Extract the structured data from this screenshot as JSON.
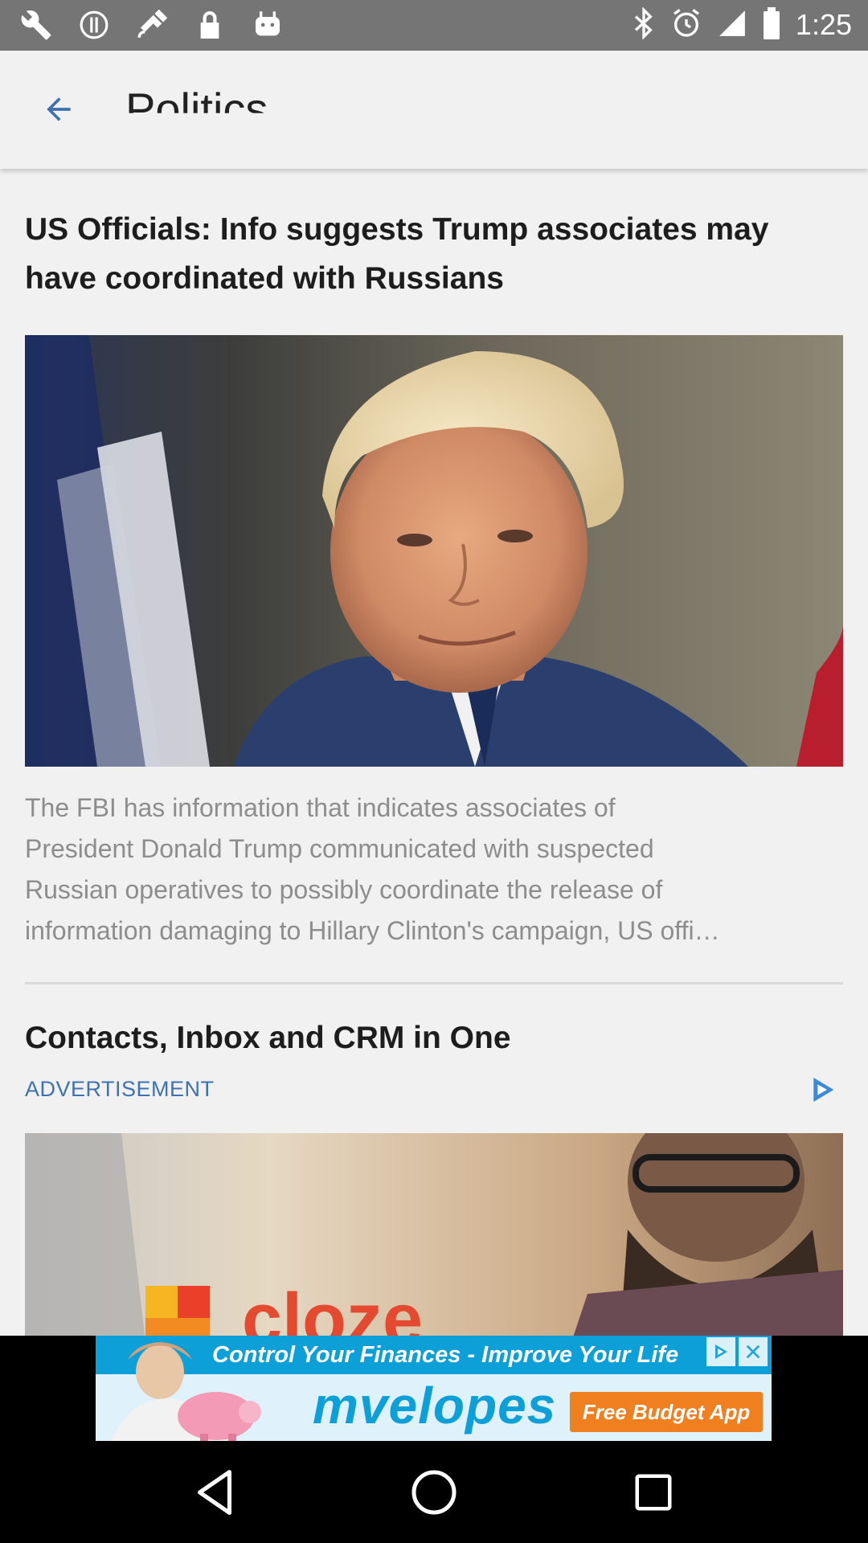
{
  "status_bar": {
    "time": "1:25",
    "left_icons": [
      "wrench-icon",
      "alert-icon",
      "satellite-icon",
      "lock-icon",
      "android-icon"
    ],
    "right_icons": [
      "bluetooth-icon",
      "alarm-icon",
      "signal-icon",
      "battery-icon"
    ]
  },
  "app_bar": {
    "title": "Politics"
  },
  "article": {
    "headline": "US Officials: Info suggests Trump associates may have coordinated with Russians",
    "summary_lines": [
      "The FBI has information that indicates associates of",
      "President Donald Trump communicated with suspected",
      "Russian operatives to possibly coordinate the release of",
      "information damaging to Hillary Clinton's campaign, US offi…"
    ]
  },
  "ad": {
    "title": "Contacts, Inbox and CRM in One",
    "label": "ADVERTISEMENT",
    "image_brand": "cloze"
  },
  "banner": {
    "tagline": "Control Your Finances - Improve Your Life",
    "brand": "mvelopes",
    "cta": "Free Budget App"
  },
  "colors": {
    "status_bar": "#757575",
    "app_bar": "#f1f1f1",
    "ad_label": "#3e72b2",
    "banner_accent": "#0c9fd8",
    "banner_cta": "#f07f1f"
  }
}
